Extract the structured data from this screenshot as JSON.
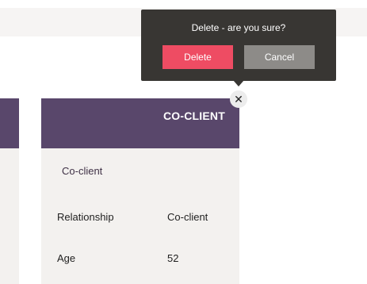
{
  "popover": {
    "message": "Delete - are you sure?",
    "delete_label": "Delete",
    "cancel_label": "Cancel"
  },
  "close_button": {
    "icon": "close-icon",
    "glyph": "✕"
  },
  "card": {
    "header_title": "CO-CLIENT",
    "subtitle": "Co-client",
    "fields": [
      {
        "label": "Relationship",
        "value": "Co-client"
      },
      {
        "label": "Age",
        "value": "52"
      }
    ]
  },
  "colors": {
    "header_purple": "#59476b",
    "card_background": "#f3f1ef",
    "popover_background": "#383633",
    "delete_red": "#ee4c63",
    "cancel_grey": "#8d8b88"
  }
}
